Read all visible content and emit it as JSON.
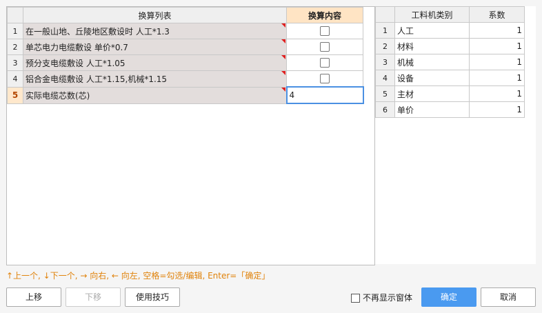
{
  "left_table": {
    "headers": [
      "",
      "换算列表",
      "换算内容"
    ],
    "rows": [
      {
        "num": "1",
        "name": "在一般山地、丘陵地区敷设时 人工*1.3",
        "value": ""
      },
      {
        "num": "2",
        "name": "单芯电力电缆敷设 单价*0.7",
        "value": ""
      },
      {
        "num": "3",
        "name": "预分支电缆敷设 人工*1.05",
        "value": ""
      },
      {
        "num": "4",
        "name": "铝合金电缆敷设 人工*1.15,机械*1.15",
        "value": ""
      },
      {
        "num": "5",
        "name": "实际电缆芯数(芯)",
        "value": "4"
      }
    ]
  },
  "right_table": {
    "headers": [
      "",
      "工料机类别",
      "系数"
    ],
    "rows": [
      {
        "num": "1",
        "name": "人工",
        "value": "1"
      },
      {
        "num": "2",
        "name": "材料",
        "value": "1"
      },
      {
        "num": "3",
        "name": "机械",
        "value": "1"
      },
      {
        "num": "4",
        "name": "设备",
        "value": "1"
      },
      {
        "num": "5",
        "name": "主材",
        "value": "1"
      },
      {
        "num": "6",
        "name": "单价",
        "value": "1"
      }
    ]
  },
  "hint": "↑上一个, ↓下一个, → 向右, ← 向左, 空格=勾选/编辑, Enter=「确定」",
  "buttons": {
    "move_up": "上移",
    "move_down": "下移",
    "tips": "使用技巧",
    "no_show": "不再显示窗体",
    "ok": "确定",
    "cancel": "取消"
  },
  "colors": {
    "accent": "#4a9af0",
    "hint": "#e0820a",
    "flag": "#e02020"
  }
}
